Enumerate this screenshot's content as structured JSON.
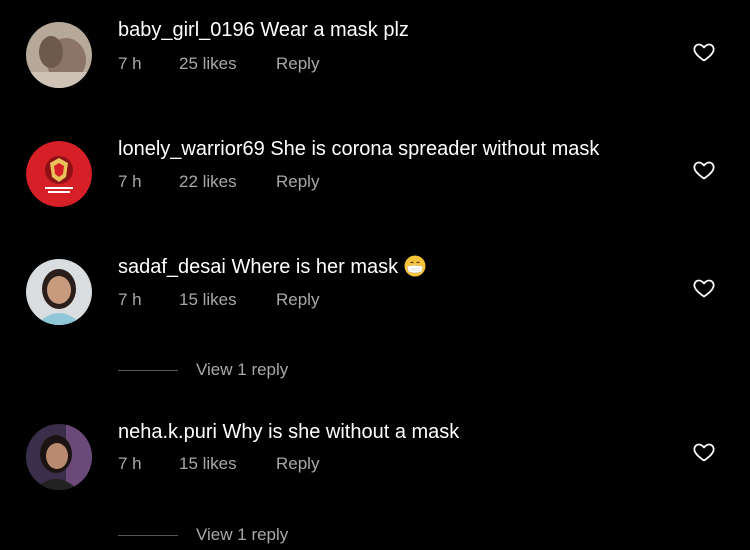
{
  "comments": [
    {
      "username": "baby_girl_0196",
      "text": "Wear a mask plz",
      "time": "7 h",
      "likes": "25 likes",
      "reply": "Reply"
    },
    {
      "username": "lonely_warrior69",
      "text": "She is corona spreader without mask",
      "time": "7 h",
      "likes": "22 likes",
      "reply": "Reply"
    },
    {
      "username": "sadaf_desai",
      "text": "Where is her mask",
      "time": "7 h",
      "likes": "15 likes",
      "reply": "Reply"
    },
    {
      "username": "neha.k.puri",
      "text": "Why is she without a mask",
      "time": "7 h",
      "likes": "15 likes",
      "reply": "Reply"
    }
  ],
  "view_replies": [
    "View 1 reply",
    "View 1 reply"
  ],
  "icons": {
    "like": "heart-outline-icon",
    "emoji": "mask-face-emoji"
  },
  "colors": {
    "background": "#000000",
    "text": "#ffffff",
    "muted": "#a8a8a8",
    "rcb_red": "#d61f26"
  }
}
